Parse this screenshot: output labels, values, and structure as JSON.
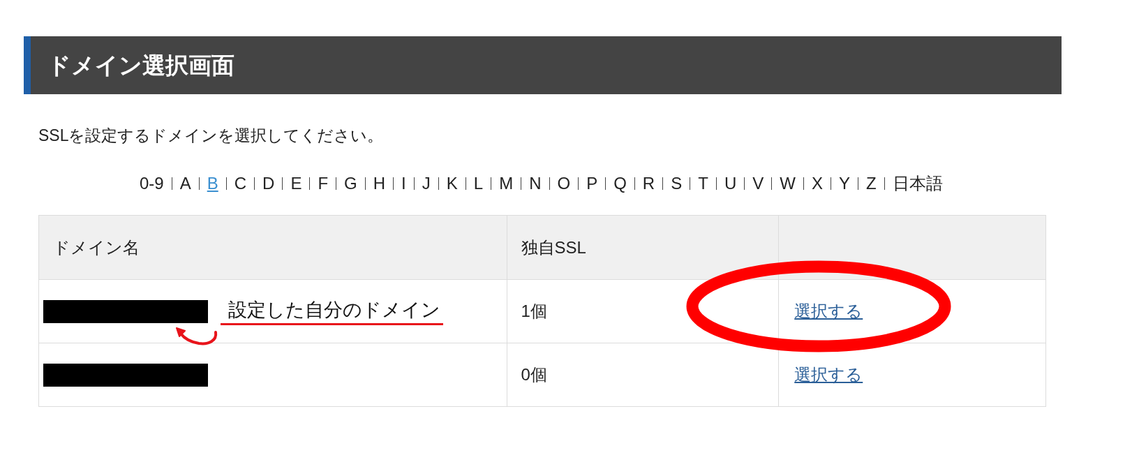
{
  "heading": "ドメイン選択画面",
  "instruction": "SSLを設定するドメインを選択してください。",
  "index": [
    {
      "label": "0-9",
      "selected": false
    },
    {
      "label": "A",
      "selected": false
    },
    {
      "label": "B",
      "selected": true
    },
    {
      "label": "C",
      "selected": false
    },
    {
      "label": "D",
      "selected": false
    },
    {
      "label": "E",
      "selected": false
    },
    {
      "label": "F",
      "selected": false
    },
    {
      "label": "G",
      "selected": false
    },
    {
      "label": "H",
      "selected": false
    },
    {
      "label": "I",
      "selected": false
    },
    {
      "label": "J",
      "selected": false
    },
    {
      "label": "K",
      "selected": false
    },
    {
      "label": "L",
      "selected": false
    },
    {
      "label": "M",
      "selected": false
    },
    {
      "label": "N",
      "selected": false
    },
    {
      "label": "O",
      "selected": false
    },
    {
      "label": "P",
      "selected": false
    },
    {
      "label": "Q",
      "selected": false
    },
    {
      "label": "R",
      "selected": false
    },
    {
      "label": "S",
      "selected": false
    },
    {
      "label": "T",
      "selected": false
    },
    {
      "label": "U",
      "selected": false
    },
    {
      "label": "V",
      "selected": false
    },
    {
      "label": "W",
      "selected": false
    },
    {
      "label": "X",
      "selected": false
    },
    {
      "label": "Y",
      "selected": false
    },
    {
      "label": "Z",
      "selected": false
    },
    {
      "label": "日本語",
      "selected": false
    }
  ],
  "table": {
    "columns": [
      "ドメイン名",
      "独自SSL"
    ],
    "rows": [
      {
        "domain_redacted": true,
        "note": "設定した自分のドメイン",
        "ssl": "1個",
        "action": "選択する",
        "circled": true
      },
      {
        "domain_redacted": true,
        "ssl": "0個",
        "action": "選択する",
        "circled": false
      }
    ]
  }
}
